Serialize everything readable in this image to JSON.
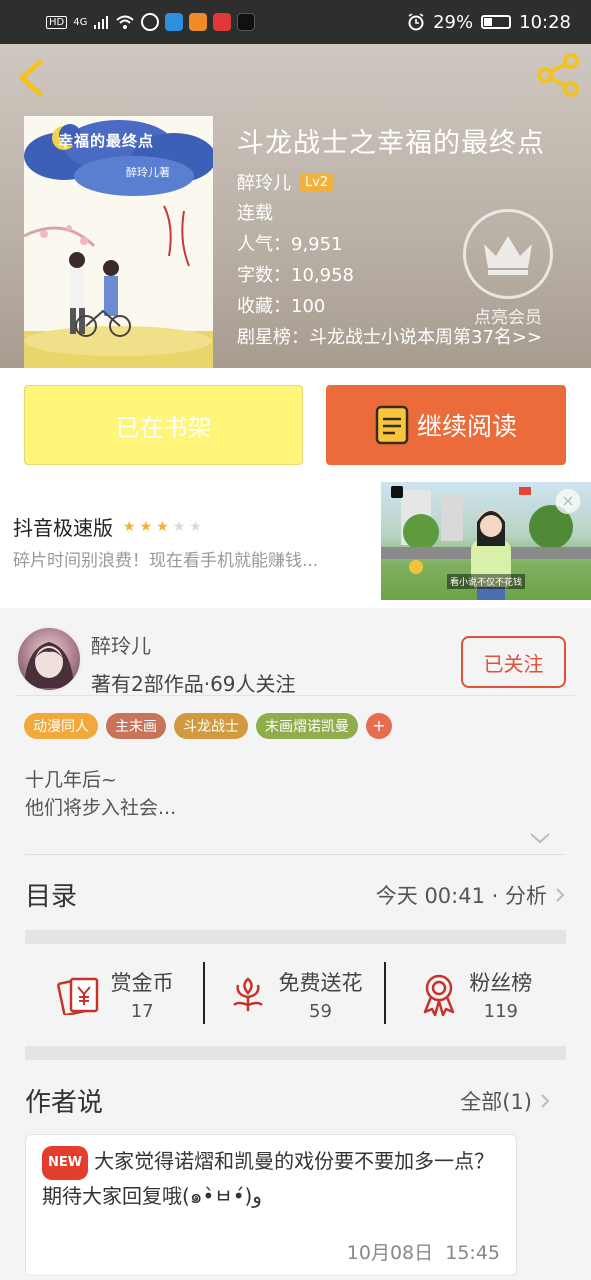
{
  "status_bar": {
    "network_tag": "HD",
    "network_gen": "4G",
    "battery_text": "29%",
    "battery_level": 0.29,
    "time": "10:28"
  },
  "header": {
    "book_title": "斗龙战士之幸福的最终点",
    "author": "醉玲儿",
    "level_badge": "Lv2",
    "status": "连载",
    "popularity": "人气：9,951",
    "word_count": "字数：10,958",
    "favorites": "收藏：100",
    "ranking": "剧星榜：斗龙战士小说本周第37名>>",
    "vip_label": "点亮会员",
    "cover_title": "幸福的最终点",
    "cover_author": "醉玲儿著"
  },
  "buttons": {
    "shelf": "已在书架",
    "read": "继续阅读"
  },
  "ad": {
    "app_name": "抖音极速版",
    "rating": 3,
    "rating_max": 5,
    "description": "碎片时间别浪费！现在看手机就能赚钱...",
    "caption": "看小说不仅不花钱",
    "close": "×"
  },
  "author_block": {
    "name": "醉玲儿",
    "stats": "著有2部作品·69人关注",
    "follow": "已关注"
  },
  "tags": [
    {
      "label": "动漫同人",
      "color": "#f2a93b"
    },
    {
      "label": "主末画",
      "color": "#c8745a"
    },
    {
      "label": "斗龙战士",
      "color": "#d29a3e"
    },
    {
      "label": "末画熠诺凯曼",
      "color": "#8fae4b"
    }
  ],
  "tag_add": "+",
  "intro": {
    "line1": "十几年后~",
    "line2": "他们将步入社会..."
  },
  "catalog": {
    "title": "目录",
    "update": "今天 00:41 · 分析"
  },
  "actions": [
    {
      "label": "赏金币",
      "count": "17"
    },
    {
      "label": "免费送花",
      "count": "59"
    },
    {
      "label": "粉丝榜",
      "count": "119"
    }
  ],
  "author_say": {
    "title": "作者说",
    "all": "全部(1)"
  },
  "note": {
    "badge": "NEW",
    "text": "大家觉得诺熠和凯曼的戏份要不要加多一点？期待大家回复哦(๑•̀ㅂ•́)و",
    "date": "10月08日",
    "time": "15:45"
  },
  "colors": {
    "accent_orange": "#eb6b3a",
    "shelf_yellow": "#fef57a",
    "follow_red": "#e2503a",
    "icon_red": "#c7322a"
  }
}
